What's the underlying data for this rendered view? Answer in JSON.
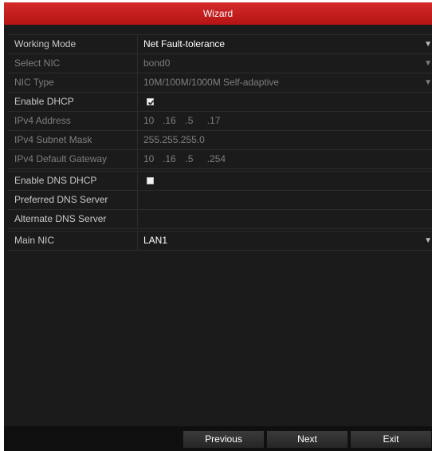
{
  "window": {
    "title": "Wizard"
  },
  "fields": {
    "working_mode": {
      "label": "Working Mode",
      "value": "Net Fault-tolerance"
    },
    "select_nic": {
      "label": "Select NIC",
      "value": "bond0"
    },
    "nic_type": {
      "label": "NIC Type",
      "value": "10M/100M/1000M Self-adaptive"
    },
    "enable_dhcp": {
      "label": "Enable DHCP",
      "checked": true
    },
    "ipv4_address": {
      "label": "IPv4 Address",
      "octets": [
        "10",
        "16",
        "5",
        "17"
      ]
    },
    "ipv4_subnet_mask": {
      "label": "IPv4 Subnet Mask",
      "octets": [
        "255",
        "255",
        "255",
        "0"
      ]
    },
    "ipv4_default_gateway": {
      "label": "IPv4 Default Gateway",
      "octets": [
        "10",
        "16",
        "5",
        "254"
      ]
    },
    "enable_dns_dhcp": {
      "label": "Enable DNS DHCP",
      "checked": false
    },
    "preferred_dns_server": {
      "label": "Preferred DNS Server",
      "value": ""
    },
    "alternate_dns_server": {
      "label": "Alternate DNS Server",
      "value": ""
    },
    "main_nic": {
      "label": "Main NIC",
      "value": "LAN1"
    }
  },
  "buttons": {
    "previous": "Previous",
    "next": "Next",
    "exit": "Exit"
  },
  "colors": {
    "title_bar": "#c41f1f",
    "background": "#1b1b1b",
    "text_active": "#ffffff",
    "text_disabled": "#7e7e7e"
  }
}
